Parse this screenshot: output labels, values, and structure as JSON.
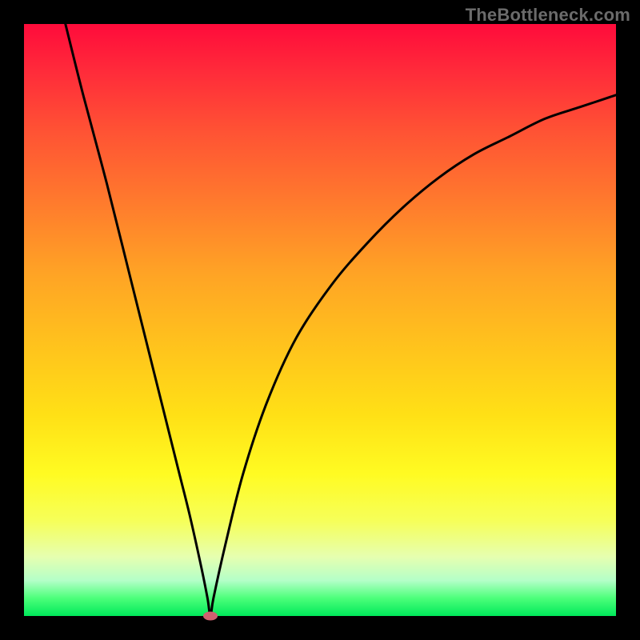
{
  "attribution": "TheBottleneck.com",
  "colors": {
    "frame": "#000000",
    "curve": "#000000",
    "marker": "#d06070",
    "gradient_top": "#ff0b3b",
    "gradient_bottom": "#00e85a"
  },
  "chart_data": {
    "type": "line",
    "title": "",
    "xlabel": "",
    "ylabel": "",
    "xlim": [
      0,
      100
    ],
    "ylim": [
      0,
      100
    ],
    "series": [
      {
        "name": "bottleneck-curve",
        "x": [
          7,
          10,
          14,
          18,
          22,
          26,
          28,
          30,
          31,
          31.5,
          32,
          34,
          37,
          41,
          46,
          52,
          58,
          64,
          70,
          76,
          82,
          88,
          94,
          100
        ],
        "y": [
          100,
          88,
          73,
          57,
          41,
          25,
          17,
          8,
          3,
          0,
          3,
          12,
          24,
          36,
          47,
          56,
          63,
          69,
          74,
          78,
          81,
          84,
          86,
          88
        ]
      }
    ],
    "annotations": [
      {
        "name": "min-marker",
        "x": 31.5,
        "y": 0
      }
    ],
    "grid": false,
    "legend": false
  }
}
